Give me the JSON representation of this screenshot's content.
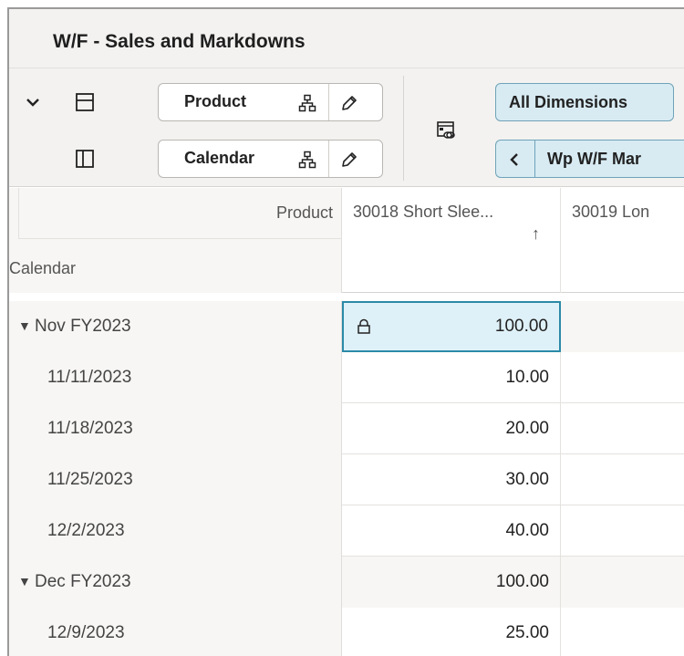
{
  "window": {
    "title": "W/F - Sales and Markdowns"
  },
  "toolbar": {
    "row_dimension": {
      "label": "Product"
    },
    "column_dimension": {
      "label": "Calendar"
    },
    "all_dimensions_button": "All Dimensions",
    "workbook_tab_label": "Wp W/F Mar"
  },
  "grid": {
    "header": {
      "product_label": "Product",
      "calendar_label": "Calendar",
      "col1": "30018 Short Slee...",
      "col1_sort_icon": "↑",
      "col2": "30019 Lon"
    },
    "rows": [
      {
        "label": "Nov FY2023",
        "value": "100.00",
        "group": true,
        "locked": true
      },
      {
        "label": "11/11/2023",
        "value": "10.00"
      },
      {
        "label": "11/18/2023",
        "value": "20.00"
      },
      {
        "label": "11/25/2023",
        "value": "30.00"
      },
      {
        "label": "12/2/2023",
        "value": "40.00"
      },
      {
        "label": "Dec FY2023",
        "value": "100.00",
        "group": true
      },
      {
        "label": "12/9/2023",
        "value": "25.00"
      }
    ]
  },
  "colors": {
    "accent": "#2b8aa8",
    "selected_cell": "#dff1f8",
    "header_bg": "#f3f2f0"
  }
}
